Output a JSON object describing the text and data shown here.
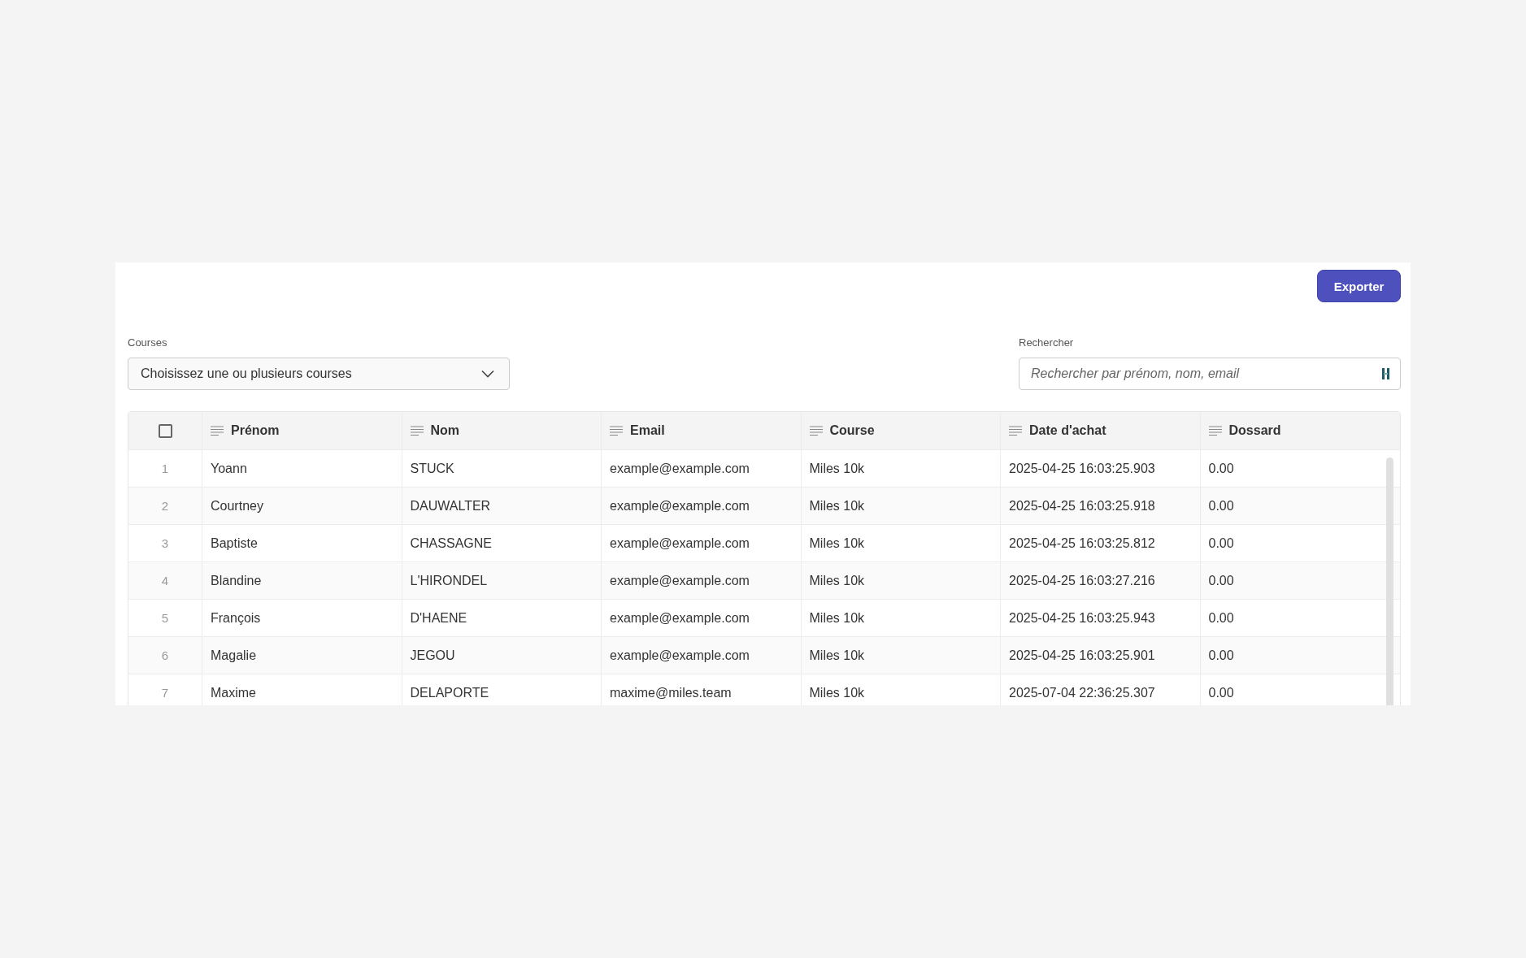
{
  "export_button": {
    "label": "Exporter"
  },
  "filters": [
    {
      "kind": "dropdown",
      "label": "Courses",
      "placeholder": "Choisissez une ou plusieurs courses"
    },
    {
      "kind": "search",
      "label": "Rechercher",
      "placeholder": "Rechercher par prénom, nom, email"
    }
  ],
  "table": {
    "select_all": {
      "checked": false
    },
    "columns": [
      "Prénom",
      "Nom",
      "Email",
      "Course",
      "Date d'achat",
      "Dossard"
    ],
    "rows": [
      {
        "index": "1",
        "cells": [
          "Yoann",
          "STUCK",
          "example@example.com",
          "Miles 10k",
          "2025-04-25 16:03:25.903",
          "0.00"
        ]
      },
      {
        "index": "2",
        "cells": [
          "Courtney",
          "DAUWALTER",
          "example@example.com",
          "Miles 10k",
          "2025-04-25 16:03:25.918",
          "0.00"
        ]
      },
      {
        "index": "3",
        "cells": [
          "Baptiste",
          "CHASSAGNE",
          "example@example.com",
          "Miles 10k",
          "2025-04-25 16:03:25.812",
          "0.00"
        ]
      },
      {
        "index": "4",
        "cells": [
          "Blandine",
          "L'HIRONDEL",
          "example@example.com",
          "Miles 10k",
          "2025-04-25 16:03:27.216",
          "0.00"
        ]
      },
      {
        "index": "5",
        "cells": [
          "François",
          "D'HAENE",
          "example@example.com",
          "Miles 10k",
          "2025-04-25 16:03:25.943",
          "0.00"
        ]
      },
      {
        "index": "6",
        "cells": [
          "Magalie",
          "JEGOU",
          "example@example.com",
          "Miles 10k",
          "2025-04-25 16:03:25.901",
          "0.00"
        ]
      },
      {
        "index": "7",
        "cells": [
          "Maxime",
          "DELAPORTE",
          "maxime@miles.team",
          "Miles 10k",
          "2025-07-04 22:36:25.307",
          "0.00"
        ]
      }
    ]
  }
}
